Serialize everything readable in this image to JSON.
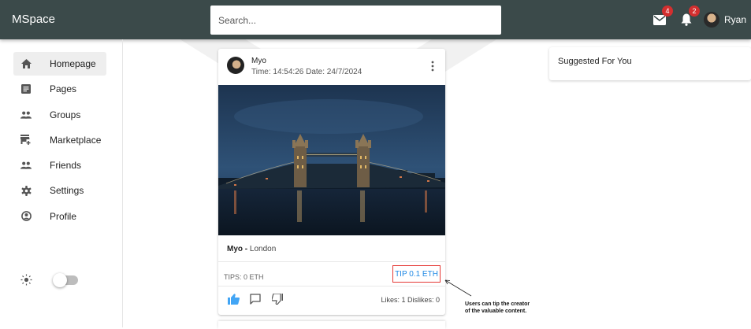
{
  "app": {
    "title": "MSpace"
  },
  "header": {
    "search_placeholder": "Search...",
    "mail_badge": "4",
    "notification_badge": "2",
    "user_name": "Ryan"
  },
  "sidebar": {
    "items": [
      {
        "label": "Homepage",
        "icon": "home-icon",
        "active": true
      },
      {
        "label": "Pages",
        "icon": "article-icon"
      },
      {
        "label": "Groups",
        "icon": "people-icon"
      },
      {
        "label": "Marketplace",
        "icon": "store-icon"
      },
      {
        "label": "Friends",
        "icon": "people-icon"
      },
      {
        "label": "Settings",
        "icon": "gear-icon"
      },
      {
        "label": "Profile",
        "icon": "account-circle-icon"
      }
    ],
    "theme_toggle": {
      "icon": "sun-icon",
      "on": false
    }
  },
  "post": {
    "author": "Myo",
    "time": "Time: 14:54:26 Date: 24/7/2024",
    "caption_author": "Myo - ",
    "caption_text": "London",
    "tips": "TIPS: 0 ETH",
    "tip_button": "TIP 0.1 ETH",
    "stats": "Likes: 1  Dislikes: 0"
  },
  "annotation": {
    "line1": "Users can tip the creator",
    "line2": "of the valuable content."
  },
  "suggested": {
    "title": "Suggested For You"
  },
  "colors": {
    "topbar": "#3b4a4a",
    "tip_border": "#e53935",
    "tip_text": "#1e88e5",
    "like": "#42a5f5",
    "badge": "#d32f2f"
  }
}
